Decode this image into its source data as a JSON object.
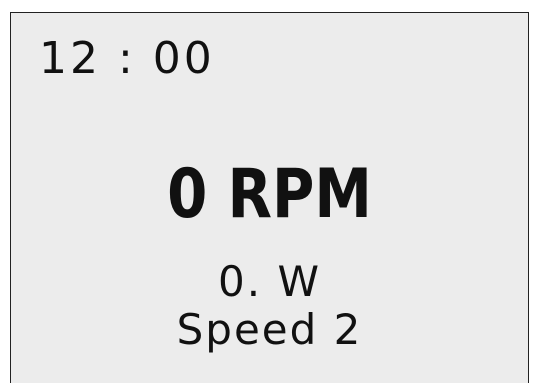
{
  "display": {
    "time": "12 : 00",
    "rpm": "0 RPM",
    "power": "0. W",
    "speed": "Speed 2"
  }
}
